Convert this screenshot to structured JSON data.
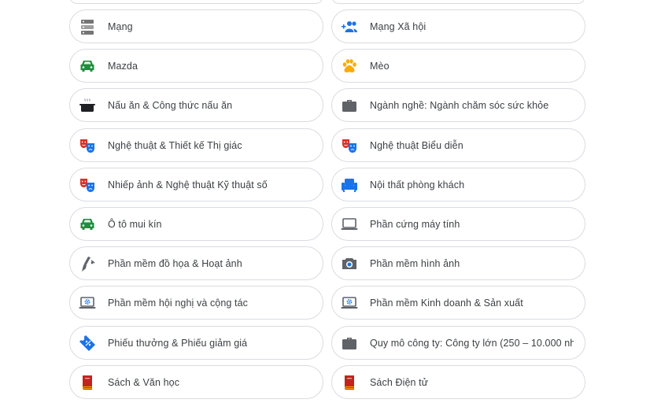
{
  "rows": [
    {
      "left": {
        "label": "Mạng",
        "icon": "server-icon"
      },
      "right": {
        "label": "Mạng Xã hội",
        "icon": "group-add-icon"
      }
    },
    {
      "left": {
        "label": "Mazda",
        "icon": "car-icon"
      },
      "right": {
        "label": "Mèo",
        "icon": "paw-icon"
      }
    },
    {
      "left": {
        "label": "Nấu ăn & Công thức nấu ăn",
        "icon": "cooking-pot-icon"
      },
      "right": {
        "label": "Ngành nghề: Ngành chăm sóc sức khỏe",
        "icon": "briefcase-icon"
      }
    },
    {
      "left": {
        "label": "Nghệ thuật & Thiết kế Thị giác",
        "icon": "theater-masks-icon"
      },
      "right": {
        "label": "Nghệ thuật Biểu diễn",
        "icon": "theater-masks-icon"
      }
    },
    {
      "left": {
        "label": "Nhiếp ảnh & Nghệ thuật Kỹ thuật số",
        "icon": "theater-masks-icon"
      },
      "right": {
        "label": "Nội thất phòng khách",
        "icon": "armchair-icon"
      }
    },
    {
      "left": {
        "label": "Ô tô mui kín",
        "icon": "car-icon"
      },
      "right": {
        "label": "Phần cứng máy tính",
        "icon": "laptop-icon"
      }
    },
    {
      "left": {
        "label": "Phần mềm đồ họa & Hoạt ảnh",
        "icon": "pen-nib-icon"
      },
      "right": {
        "label": "Phần mềm hình ảnh",
        "icon": "camera-icon"
      }
    },
    {
      "left": {
        "label": "Phần mềm hội nghị và cộng tác",
        "icon": "laptop-settings-icon"
      },
      "right": {
        "label": "Phần mềm Kinh doanh & Sản xuất",
        "icon": "laptop-settings-icon"
      }
    },
    {
      "left": {
        "label": "Phiếu thưởng & Phiếu giảm giá",
        "icon": "coupon-icon"
      },
      "right": {
        "label": "Quy mô công ty: Công ty lớn (250 – 10.000 nh...",
        "icon": "briefcase-icon"
      }
    },
    {
      "left": {
        "label": "Sách & Văn học",
        "icon": "book-icon"
      },
      "right": {
        "label": "Sách Điện tử",
        "icon": "book-icon"
      }
    }
  ],
  "colors": {
    "border": "#dadce0",
    "text": "#3c4043",
    "grey_icon": "#5f6368",
    "green": "#1e8e3e",
    "blue": "#1a73e8",
    "red": "#d93025",
    "yellow": "#f9ab00",
    "book_red": "#c5221f"
  }
}
